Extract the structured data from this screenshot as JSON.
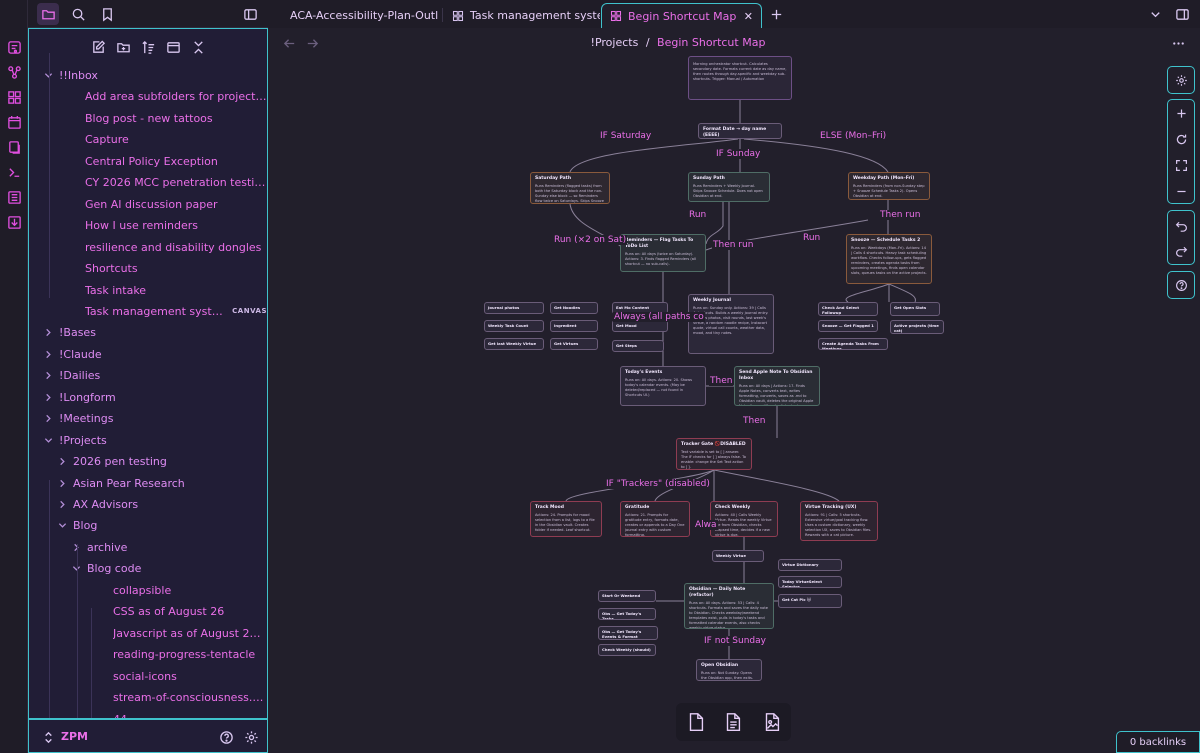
{
  "tabs": [
    {
      "label": "ACA-Accessibility-Plan-Outline...",
      "icon": "file-icon"
    },
    {
      "label": "Task management system ...",
      "icon": "canvas-icon"
    },
    {
      "label": "Begin Shortcut Map",
      "icon": "canvas-icon",
      "active": true
    }
  ],
  "breadcrumb": {
    "parent": "!Projects",
    "sep": "/",
    "current": "Begin Shortcut Map"
  },
  "tree": [
    {
      "label": "!!Inbox",
      "type": "folder",
      "depth": 0,
      "open": true
    },
    {
      "label": "Add area subfolders for projects and r...",
      "type": "file",
      "depth": 1
    },
    {
      "label": "Blog post - new tattoos",
      "type": "file",
      "depth": 1
    },
    {
      "label": "Capture",
      "type": "file",
      "depth": 1
    },
    {
      "label": "Central Policy Exception",
      "type": "file",
      "depth": 1
    },
    {
      "label": "CY 2026 MCC penetration testing",
      "type": "file",
      "depth": 1
    },
    {
      "label": "Gen AI discussion paper",
      "type": "file",
      "depth": 1
    },
    {
      "label": "How I use reminders",
      "type": "file",
      "depth": 1
    },
    {
      "label": "resilience and disability dongles",
      "type": "file",
      "depth": 1
    },
    {
      "label": "Shortcuts",
      "type": "file",
      "depth": 1
    },
    {
      "label": "Task intake",
      "type": "file",
      "depth": 1
    },
    {
      "label": "Task management system - S...",
      "type": "file",
      "depth": 1,
      "badge": "CANVAS"
    },
    {
      "label": "!Bases",
      "type": "folder",
      "depth": 0,
      "open": false
    },
    {
      "label": "!Claude",
      "type": "folder",
      "depth": 0,
      "open": false
    },
    {
      "label": "!Dailies",
      "type": "folder",
      "depth": 0,
      "open": false
    },
    {
      "label": "!Longform",
      "type": "folder",
      "depth": 0,
      "open": false
    },
    {
      "label": "!Meetings",
      "type": "folder",
      "depth": 0,
      "open": false
    },
    {
      "label": "!Projects",
      "type": "folder",
      "depth": 0,
      "open": true
    },
    {
      "label": "2026 pen testing",
      "type": "folder",
      "depth": 1,
      "open": false
    },
    {
      "label": "Asian Pear Research",
      "type": "folder",
      "depth": 1,
      "open": false
    },
    {
      "label": "AX Advisors",
      "type": "folder",
      "depth": 1,
      "open": false
    },
    {
      "label": "Blog",
      "type": "folder",
      "depth": 1,
      "open": true
    },
    {
      "label": "archive",
      "type": "folder",
      "depth": 2,
      "open": false
    },
    {
      "label": "Blog code",
      "type": "folder",
      "depth": 2,
      "open": true
    },
    {
      "label": "collapsible",
      "type": "file",
      "depth": 3
    },
    {
      "label": "CSS as of August 26",
      "type": "file",
      "depth": 3
    },
    {
      "label": "Javascript as of August 2026",
      "type": "file",
      "depth": 3
    },
    {
      "label": "reading-progress-tentacle",
      "type": "file",
      "depth": 3
    },
    {
      "label": "social-icons",
      "type": "file",
      "depth": 3
    },
    {
      "label": "stream-of-consciousness.css",
      "type": "file",
      "depth": 3
    },
    {
      "label": "44",
      "type": "file",
      "depth": 3
    }
  ],
  "vault": {
    "name": "ZPM"
  },
  "canvas": {
    "nodes": [
      {
        "id": "n_top",
        "title": "",
        "body": "Morning orchestrator shortcut. Calculates secondary date. Formats current date as day name, then routes through day-specific and weekday sub-shortcuts. Trigger: Manual / Automation",
        "style": "pur"
      },
      {
        "id": "n_fmt",
        "title": "Format Date → day name (EEEE)",
        "body": "Routes based on Saturday / Sunday / Weekday",
        "style": ""
      },
      {
        "id": "n_sat",
        "title": "Saturday Path",
        "body": "Runs Reminders (flagged tasks) from both the Saturday block and the non-Sunday else block — so Reminders flow twice on Saturdays. Skips Snooze Schedule.",
        "style": "org"
      },
      {
        "id": "n_sun",
        "title": "Sunday Path",
        "body": "Runs Reminders + Weekly Journal. Skips Snooze Schedule. Does not open Obsidian at end.",
        "style": "grn"
      },
      {
        "id": "n_wkd",
        "title": "Weekday Path (Mon–Fri)",
        "body": "Runs Reminders (from non-Sunday step + Snooze Schedule Tasks 2). Opens Obsidian at end.",
        "style": "org"
      },
      {
        "id": "n_rem",
        "title": "Reminders — Flag Tasks To ToDo List",
        "body": "Runs on: All days (twice on Saturday). Actions: 3. Finds flagged Reminders (all shortcut — no sub-calls).",
        "style": "grn"
      },
      {
        "id": "n_snz",
        "title": "Snooze — Schedule Tasks 2",
        "body": "Runs on: Weekdays (Mon–Fri). Actions: 14 | Calls 4 shortcuts. Heavy task scheduling workflow. Checks follow-ups, gets flagged reminders, creates agenda tasks from upcoming meetings, finds open calendar slots, queues tasks on the active projects.",
        "style": "org"
      },
      {
        "id": "n_wj",
        "title": "Weekly Journal",
        "body": "Runs on: Sunday only. Actions: 39 | Calls 4 shortcuts. Builds a weekly journal entry. Gathers photos, visit rounds, last week's Virtue, a random noodle recipe, Instacart quote, virtual call counts, weather data, mood, and tiny notes.",
        "style": ""
      },
      {
        "id": "n_te",
        "title": "Today's Events",
        "body": "Runs on: All days. Actions: 20. Shows today's calendar events. (May be deleted/replaced — not found in Shortcuts UI.)",
        "style": ""
      },
      {
        "id": "n_sa",
        "title": "Send Apple Note To Obsidian Inbox",
        "body": "Runs on: All days | Actions: 17. Finds Apple Notes, converts text, writes formatting, converts, saves as .md to Obsidian vault, deletes the original Apple Note, then notifies. Leaf shortcut.",
        "style": "grn"
      },
      {
        "id": "n_tg",
        "title": "Tracker Gate 🚫DISABLED",
        "body": "Text variable is set to [ ] answer. The IF checks for [ ] always false. To enable: change the Set Text action to [ ].",
        "style": "red"
      },
      {
        "id": "n_tm",
        "title": "Track Mood",
        "body": "Actions: 24. Prompts for mood selection from a list, logs to a file in the Obsidian vault. Creates folder if needed. Leaf shortcut.",
        "style": "red"
      },
      {
        "id": "n_gr",
        "title": "Gratitude",
        "body": "Actions: 21. Prompts for gratitude entry, formats date, creates or appends to a Day One journal entry with custom formatting.",
        "style": "red"
      },
      {
        "id": "n_cw",
        "title": "Check Weekly",
        "body": "Actions: 40 | Calls Weekly Virtue. Reads the weekly Virtue file from Obsidian, checks elapsed time, decides if a new virtue is due.",
        "style": "red"
      },
      {
        "id": "n_vt",
        "title": "Virtue Tracking (UX)",
        "body": "Actions: 91 | Calls: 5 shortcuts. Extensive virtue/goal tracking flow. Uses a custom dictionary, weekly selection UX, saves to Obsidian files. Rewards with a cat picture.",
        "style": "red"
      },
      {
        "id": "n_ob",
        "title": "Obsidian — Daily Note (refactor)",
        "body": "Runs on: All days. Actions: 53 | Calls: 4 shortcuts. Formats and saves the daily note to Obsidian. Checks weekday/weekend templates exist, pulls in today's tasks and formatted calendar events, also checks weekly virtue status.",
        "style": "grn"
      },
      {
        "id": "n_od",
        "title": "Open Obsidian",
        "body": "Runs on: Not Sunday. Opens the Obsidian app, then exits.",
        "style": ""
      }
    ],
    "small_nodes": [
      "Journal photos",
      "Get Noodles",
      "Weekly Task Count",
      "Ingredient",
      "Get last Weekly Virtue",
      "Get Virtues",
      "Eat Mo Content",
      "Get Mood",
      "Get Steps",
      "Check And Select Followup",
      "Get Open Slots",
      "Snooze — Get Flagged 1",
      "Active projects (time cat)",
      "Create Agenda Tasks From Meetings",
      "Weekly Virtue",
      "Virtue Dictionary",
      "Today VirtueSelect Selector",
      "Get Cat Pic 🐱",
      "Start Or Weekend",
      "Obs — Get Today's Tasks",
      "Obs — Get Today's Events & Format",
      "Check Weekly (should)"
    ],
    "edge_labels": [
      "IF Saturday",
      "IF Sunday",
      "ELSE (Mon–Fri)",
      "Run",
      "Then run",
      "Run (×2 on Sat)",
      "Then run",
      "Run",
      "Always (all paths co",
      "Then",
      "Then",
      "IF \"Trackers\" (disabled)",
      "Alwa",
      "IF not Sunday"
    ]
  },
  "canvas_controls": [
    "settings",
    "zoom-in",
    "reset-zoom",
    "fit",
    "zoom-out",
    "undo",
    "redo",
    "help"
  ],
  "card_menu": [
    "new-note-card",
    "file-card",
    "media-card"
  ],
  "backlinks": {
    "count": "0",
    "label": "0 backlinks"
  },
  "colors": {
    "accent": "#ea6fe8",
    "border": "#3fc2cc",
    "bg": "#221f2b"
  }
}
